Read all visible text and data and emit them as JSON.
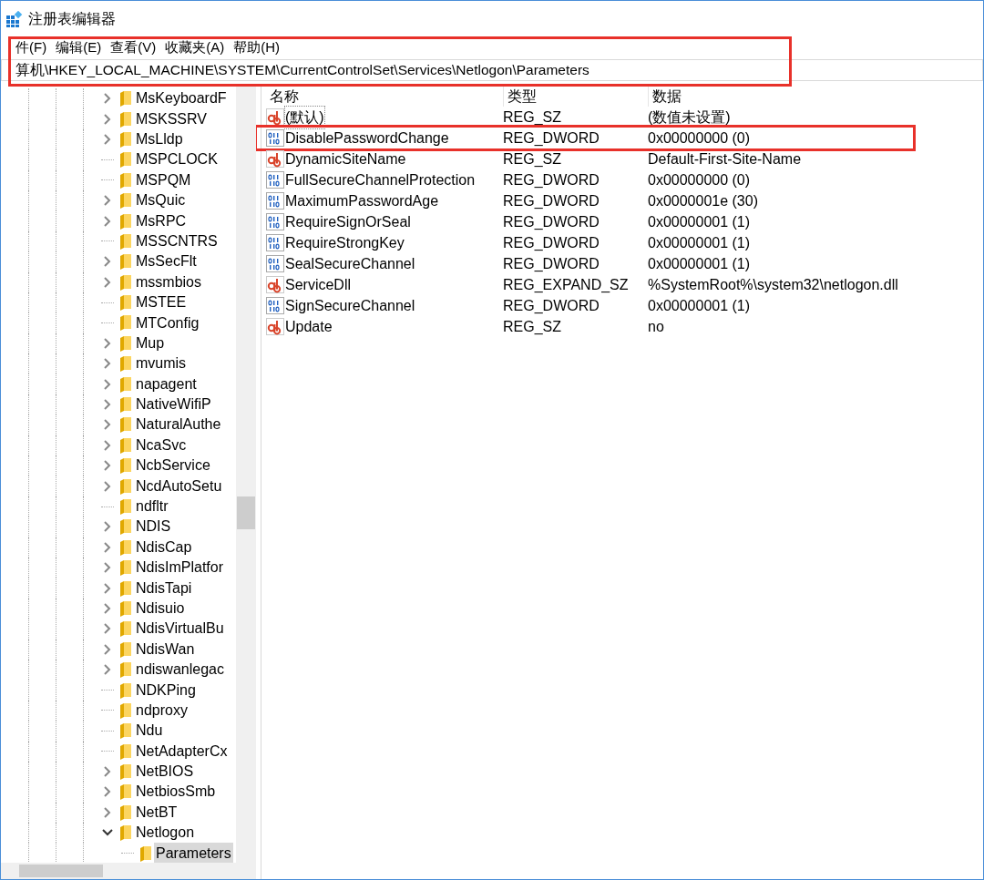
{
  "window": {
    "title": "注册表编辑器"
  },
  "menu": {
    "highlighted": true,
    "items": [
      "件(F)",
      "编辑(E)",
      "查看(V)",
      "收藏夹(A)",
      "帮助(H)"
    ],
    "address": "算机\\HKEY_LOCAL_MACHINE\\SYSTEM\\CurrentControlSet\\Services\\Netlogon\\Parameters"
  },
  "tree": [
    {
      "kind": "branch",
      "name": "MsKeyboardF",
      "expanded": false,
      "selected": false
    },
    {
      "kind": "branch",
      "name": "MSKSSRV",
      "expanded": false,
      "selected": false
    },
    {
      "kind": "branch",
      "name": "MsLldp",
      "expanded": false,
      "selected": false
    },
    {
      "kind": "leaf",
      "name": "MSPCLOCK",
      "selected": false
    },
    {
      "kind": "leaf",
      "name": "MSPQM",
      "selected": false
    },
    {
      "kind": "branch",
      "name": "MsQuic",
      "expanded": false,
      "selected": false
    },
    {
      "kind": "branch",
      "name": "MsRPC",
      "expanded": false,
      "selected": false
    },
    {
      "kind": "leaf",
      "name": "MSSCNTRS",
      "selected": false
    },
    {
      "kind": "branch",
      "name": "MsSecFlt",
      "expanded": false,
      "selected": false
    },
    {
      "kind": "branch",
      "name": "mssmbios",
      "expanded": false,
      "selected": false
    },
    {
      "kind": "leaf",
      "name": "MSTEE",
      "selected": false
    },
    {
      "kind": "leaf",
      "name": "MTConfig",
      "selected": false
    },
    {
      "kind": "branch",
      "name": "Mup",
      "expanded": false,
      "selected": false
    },
    {
      "kind": "branch",
      "name": "mvumis",
      "expanded": false,
      "selected": false
    },
    {
      "kind": "branch",
      "name": "napagent",
      "expanded": false,
      "selected": false
    },
    {
      "kind": "branch",
      "name": "NativeWifiP",
      "expanded": false,
      "selected": false
    },
    {
      "kind": "branch",
      "name": "NaturalAuthe",
      "expanded": false,
      "selected": false
    },
    {
      "kind": "branch",
      "name": "NcaSvc",
      "expanded": false,
      "selected": false
    },
    {
      "kind": "branch",
      "name": "NcbService",
      "expanded": false,
      "selected": false
    },
    {
      "kind": "branch",
      "name": "NcdAutoSetu",
      "expanded": false,
      "selected": false
    },
    {
      "kind": "leaf",
      "name": "ndfltr",
      "selected": false
    },
    {
      "kind": "branch",
      "name": "NDIS",
      "expanded": false,
      "selected": false
    },
    {
      "kind": "branch",
      "name": "NdisCap",
      "expanded": false,
      "selected": false
    },
    {
      "kind": "branch",
      "name": "NdisImPlatfor",
      "expanded": false,
      "selected": false
    },
    {
      "kind": "branch",
      "name": "NdisTapi",
      "expanded": false,
      "selected": false
    },
    {
      "kind": "branch",
      "name": "Ndisuio",
      "expanded": false,
      "selected": false
    },
    {
      "kind": "branch",
      "name": "NdisVirtualBu",
      "expanded": false,
      "selected": false
    },
    {
      "kind": "branch",
      "name": "NdisWan",
      "expanded": false,
      "selected": false
    },
    {
      "kind": "branch",
      "name": "ndiswanlegac",
      "expanded": false,
      "selected": false
    },
    {
      "kind": "leaf",
      "name": "NDKPing",
      "selected": false
    },
    {
      "kind": "leaf",
      "name": "ndproxy",
      "selected": false
    },
    {
      "kind": "leaf",
      "name": "Ndu",
      "selected": false
    },
    {
      "kind": "leaf",
      "name": "NetAdapterCx",
      "selected": false
    },
    {
      "kind": "branch",
      "name": "NetBIOS",
      "expanded": false,
      "selected": false
    },
    {
      "kind": "branch",
      "name": "NetbiosSmb",
      "expanded": false,
      "selected": false
    },
    {
      "kind": "branch",
      "name": "NetBT",
      "expanded": false,
      "selected": false
    },
    {
      "kind": "branch",
      "name": "Netlogon",
      "expanded": true,
      "selected": false,
      "children": [
        {
          "kind": "leaf",
          "name": "Parameters",
          "selected": true
        }
      ]
    }
  ],
  "values": {
    "columns": [
      "名称",
      "类型",
      "数据"
    ],
    "rows": [
      {
        "kind": "string",
        "name": "(默认)",
        "type": "REG_SZ",
        "data": "(数值未设置)",
        "highlighted": false
      },
      {
        "kind": "binary",
        "name": "DisablePasswordChange",
        "type": "REG_DWORD",
        "data": "0x00000000 (0)",
        "highlighted": true
      },
      {
        "kind": "string",
        "name": "DynamicSiteName",
        "type": "REG_SZ",
        "data": "Default-First-Site-Name",
        "highlighted": false
      },
      {
        "kind": "binary",
        "name": "FullSecureChannelProtection",
        "type": "REG_DWORD",
        "data": "0x00000000 (0)",
        "highlighted": false
      },
      {
        "kind": "binary",
        "name": "MaximumPasswordAge",
        "type": "REG_DWORD",
        "data": "0x0000001e (30)",
        "highlighted": false
      },
      {
        "kind": "binary",
        "name": "RequireSignOrSeal",
        "type": "REG_DWORD",
        "data": "0x00000001 (1)",
        "highlighted": false
      },
      {
        "kind": "binary",
        "name": "RequireStrongKey",
        "type": "REG_DWORD",
        "data": "0x00000001 (1)",
        "highlighted": false
      },
      {
        "kind": "binary",
        "name": "SealSecureChannel",
        "type": "REG_DWORD",
        "data": "0x00000001 (1)",
        "highlighted": false
      },
      {
        "kind": "string",
        "name": "ServiceDll",
        "type": "REG_EXPAND_SZ",
        "data": "%SystemRoot%\\system32\\netlogon.dll",
        "highlighted": false
      },
      {
        "kind": "binary",
        "name": "SignSecureChannel",
        "type": "REG_DWORD",
        "data": "0x00000001 (1)",
        "highlighted": false
      },
      {
        "kind": "string",
        "name": "Update",
        "type": "REG_SZ",
        "data": "no",
        "highlighted": false
      }
    ]
  }
}
